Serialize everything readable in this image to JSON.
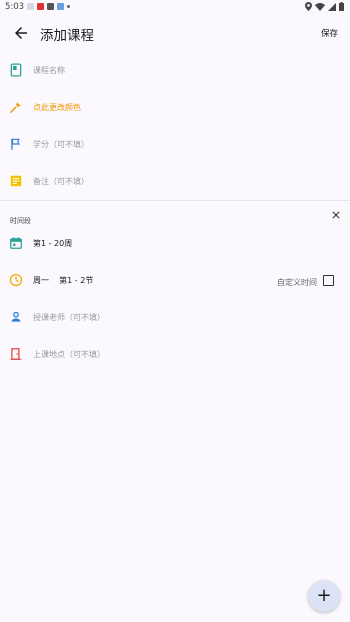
{
  "status_bar": {
    "time": "5:03"
  },
  "header": {
    "title": "添加课程",
    "save_label": "保存"
  },
  "form": {
    "course_name_placeholder": "课程名称",
    "color_label": "点此更改颜色",
    "credit_placeholder": "学分（可不填）",
    "note_placeholder": "备注（可不填）"
  },
  "time_section": {
    "label": "时间段",
    "weeks": "第1 - 20周",
    "day_period": "周一    第1 - 2节",
    "custom_time_label": "自定义时间",
    "custom_time_checked": false,
    "teacher_placeholder": "授课老师（可不填）",
    "location_placeholder": "上课地点（可不填）"
  },
  "fab": {
    "label": "+"
  },
  "colors": {
    "accent_orange": "#f29400",
    "book_icon": "#2aa198",
    "flag_icon": "#2f7fd9",
    "note_icon": "#f2c200",
    "calendar_icon": "#2aa198",
    "clock_icon": "#f2a900",
    "teacher_icon": "#2f7fd9",
    "location_icon": "#e04a4a"
  }
}
